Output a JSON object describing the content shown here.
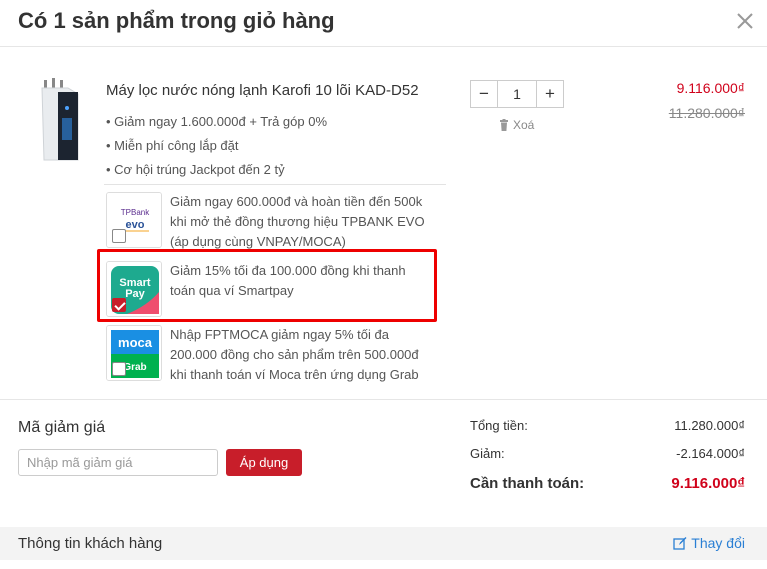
{
  "header": {
    "title": "Có 1 sản phẩm trong giỏ hàng"
  },
  "product": {
    "name": "Máy lọc nước nóng lạnh Karofi 10 lõi KAD-D52",
    "promotions": [
      "Giảm ngay 1.600.000đ + Trả góp 0%",
      "Miễn phí công lắp đặt",
      "Cơ hội trúng Jackpot đến 2 tỷ"
    ],
    "quantity": "1",
    "delete_label": "Xoá",
    "price": "9.116.000₫",
    "old_price": "11.280.000₫"
  },
  "offers": [
    {
      "logo_text_top": "TPBank",
      "logo_text_bottom": "evo",
      "line1": "Giảm ngay 600.000đ và hoàn tiền đến 500k",
      "line2": "khi mở thẻ đồng thương hiệu TPBANK EVO",
      "line3": "(áp dụng cùng VNPAY/MOCA)",
      "checked": false
    },
    {
      "logo_text_top": "Smart",
      "logo_text_bottom": "Pay",
      "line1": "Giảm 15% tối đa 100.000 đồng khi thanh",
      "line2": "toán qua ví Smartpay",
      "line3": "",
      "checked": true
    },
    {
      "logo_text_top": "moca",
      "logo_text_bottom": "Grab",
      "line1": "Nhập FPTMOCA giảm ngay 5% tối đa",
      "line2": "200.000 đồng cho sản phẩm trên 500.000đ",
      "line3": "khi thanh toán ví Moca trên ứng dụng Grab",
      "checked": false
    }
  ],
  "coupon": {
    "title": "Mã giảm giá",
    "placeholder": "Nhập mã giảm giá",
    "apply_label": "Áp dụng"
  },
  "summary": {
    "subtotal_label": "Tổng tiền:",
    "subtotal": "11.280.000₫",
    "discount_label": "Giảm:",
    "discount": "-2.164.000₫",
    "total_label": "Cần thanh toán:",
    "total": "9.116.000₫"
  },
  "customer": {
    "title": "Thông tin khách hàng",
    "edit_label": "Thay đổi"
  },
  "colors": {
    "accent_red": "#c81e2a",
    "price_red": "#d0021b",
    "link_blue": "#2a7fd4",
    "highlight_border": "#ee0000"
  }
}
